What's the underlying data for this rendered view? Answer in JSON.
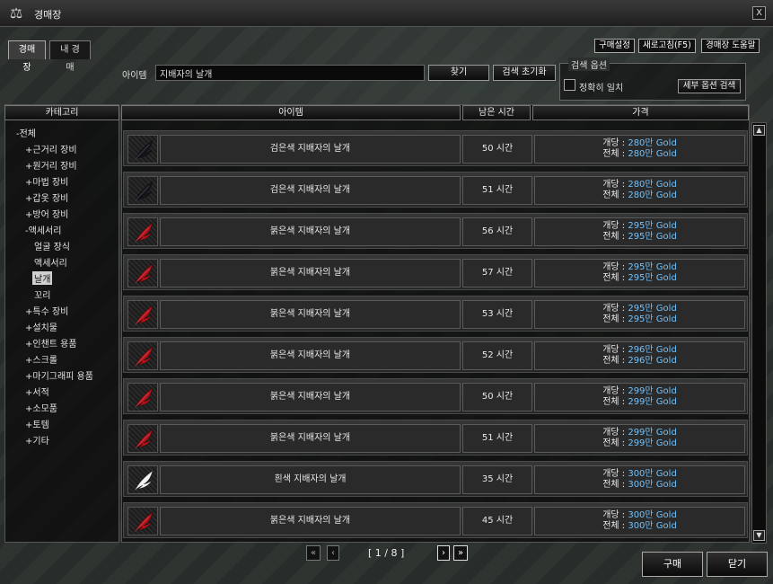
{
  "window": {
    "title": "경매장",
    "close": "X"
  },
  "tabs": [
    {
      "label": "경매장"
    },
    {
      "label": "내 경매"
    }
  ],
  "toolbar": {
    "purchase_settings": "구매설정",
    "refresh": "새로고침(F5)",
    "help": "경매장 도움말"
  },
  "search": {
    "label": "아이템",
    "value": "지배자의 날개",
    "find_button": "찾기",
    "reset_button": "검색 초기화",
    "options_title": "검색 옵션",
    "exact_match_label": "정확히 일치",
    "exact_match_checked": false,
    "detail_search_button": "세부 옵션 검색"
  },
  "columns": {
    "category": "카테고리",
    "item": "아이템",
    "time_left": "남은 시간",
    "price": "가격"
  },
  "categories": [
    {
      "label": "-전체",
      "level": 0
    },
    {
      "label": "+근거리 장비",
      "level": 1
    },
    {
      "label": "+원거리 장비",
      "level": 1
    },
    {
      "label": "+마법 장비",
      "level": 1
    },
    {
      "label": "+갑옷 장비",
      "level": 1
    },
    {
      "label": "+방어 장비",
      "level": 1
    },
    {
      "label": "-액세서리",
      "level": 1
    },
    {
      "label": "얼굴 장식",
      "level": 2
    },
    {
      "label": "액세서리",
      "level": 2
    },
    {
      "label": "날개",
      "level": 2,
      "selected": true
    },
    {
      "label": "꼬리",
      "level": 2
    },
    {
      "label": "+특수 장비",
      "level": 1
    },
    {
      "label": "+설치물",
      "level": 1
    },
    {
      "label": "+인챈트 용품",
      "level": 1
    },
    {
      "label": "+스크롤",
      "level": 1
    },
    {
      "label": "+마기그래피 용품",
      "level": 1
    },
    {
      "label": "+서적",
      "level": 1
    },
    {
      "label": "+소모품",
      "level": 1
    },
    {
      "label": "+토템",
      "level": 1
    },
    {
      "label": "+기타",
      "level": 1
    }
  ],
  "price_labels": {
    "each": "개당 : ",
    "total": "전체 : "
  },
  "items": [
    {
      "name": "검은색 지배자의 날개",
      "time": "50 시간",
      "each": "280만 Gold",
      "total": "280만 Gold",
      "icon": "black-wing-icon"
    },
    {
      "name": "검은색 지배자의 날개",
      "time": "51 시간",
      "each": "280만 Gold",
      "total": "280만 Gold",
      "icon": "black-wing-icon"
    },
    {
      "name": "붉은색 지배자의 날개",
      "time": "56 시간",
      "each": "295만 Gold",
      "total": "295만 Gold",
      "icon": "red-wing-icon"
    },
    {
      "name": "붉은색 지배자의 날개",
      "time": "57 시간",
      "each": "295만 Gold",
      "total": "295만 Gold",
      "icon": "red-wing-icon"
    },
    {
      "name": "붉은색 지배자의 날개",
      "time": "53 시간",
      "each": "295만 Gold",
      "total": "295만 Gold",
      "icon": "red-wing-icon"
    },
    {
      "name": "붉은색 지배자의 날개",
      "time": "52 시간",
      "each": "296만 Gold",
      "total": "296만 Gold",
      "icon": "red-wing-icon"
    },
    {
      "name": "붉은색 지배자의 날개",
      "time": "50 시간",
      "each": "299만 Gold",
      "total": "299만 Gold",
      "icon": "red-wing-icon"
    },
    {
      "name": "붉은색 지배자의 날개",
      "time": "51 시간",
      "each": "299만 Gold",
      "total": "299만 Gold",
      "icon": "red-wing-icon"
    },
    {
      "name": "흰색 지배자의 날개",
      "time": "35 시간",
      "each": "300만 Gold",
      "total": "300만 Gold",
      "icon": "white-wing-icon"
    },
    {
      "name": "붉은색 지배자의 날개",
      "time": "45 시간",
      "each": "300만 Gold",
      "total": "300만 Gold",
      "icon": "red-wing-icon"
    }
  ],
  "pagination": {
    "text": "[ 1 / 8 ]",
    "first": "«",
    "prev": "‹",
    "next": "›",
    "last": "»"
  },
  "footer": {
    "buy": "구매",
    "close": "닫기"
  },
  "colors": {
    "gold_text": "#6fc3ff",
    "wing_black": "#15151c",
    "wing_red": "#b3121a",
    "wing_white": "#f2f2f2"
  }
}
